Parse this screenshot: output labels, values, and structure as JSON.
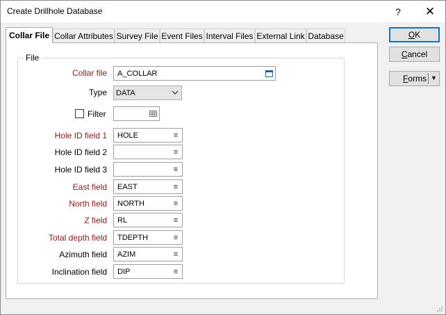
{
  "window": {
    "title": "Create Drillhole Database",
    "help_label": "?",
    "close_label": "✕"
  },
  "tabs": [
    {
      "label": "Collar File",
      "active": true
    },
    {
      "label": "Collar Attributes"
    },
    {
      "label": "Survey File"
    },
    {
      "label": "Event Files"
    },
    {
      "label": "Interval Files"
    },
    {
      "label": "External Link"
    },
    {
      "label": "Database"
    }
  ],
  "group": {
    "legend": "File"
  },
  "collar_file": {
    "label": "Collar file",
    "value": "A_COLLAR",
    "icon": "file-browse-icon"
  },
  "type": {
    "label": "Type",
    "value": "DATA"
  },
  "filter": {
    "label": "Filter",
    "checked": false,
    "value": "",
    "icon": "filter-table-icon"
  },
  "fields": [
    {
      "label": "Hole ID field 1",
      "value": "HOLE",
      "required": true
    },
    {
      "label": "Hole ID field 2",
      "value": "",
      "required": false
    },
    {
      "label": "Hole ID field 3",
      "value": "",
      "required": false
    },
    {
      "label": "East field",
      "value": "EAST",
      "required": true
    },
    {
      "label": "North field",
      "value": "NORTH",
      "required": true
    },
    {
      "label": "Z field",
      "value": "RL",
      "required": true
    },
    {
      "label": "Total depth field",
      "value": "TDEPTH",
      "required": true
    },
    {
      "label": "Azimuth field",
      "value": "AZIM",
      "required": false
    },
    {
      "label": "Inclination field",
      "value": "DIP",
      "required": false
    }
  ],
  "buttons": {
    "ok": {
      "mnemonic": "O",
      "rest": "K"
    },
    "cancel": {
      "mnemonic": "C",
      "rest": "ancel"
    },
    "forms": {
      "mnemonic": "F",
      "rest": "orms",
      "arrow": "▼"
    }
  },
  "colors": {
    "required_label": "#8b1a1a",
    "default_button_border": "#0078d7"
  }
}
